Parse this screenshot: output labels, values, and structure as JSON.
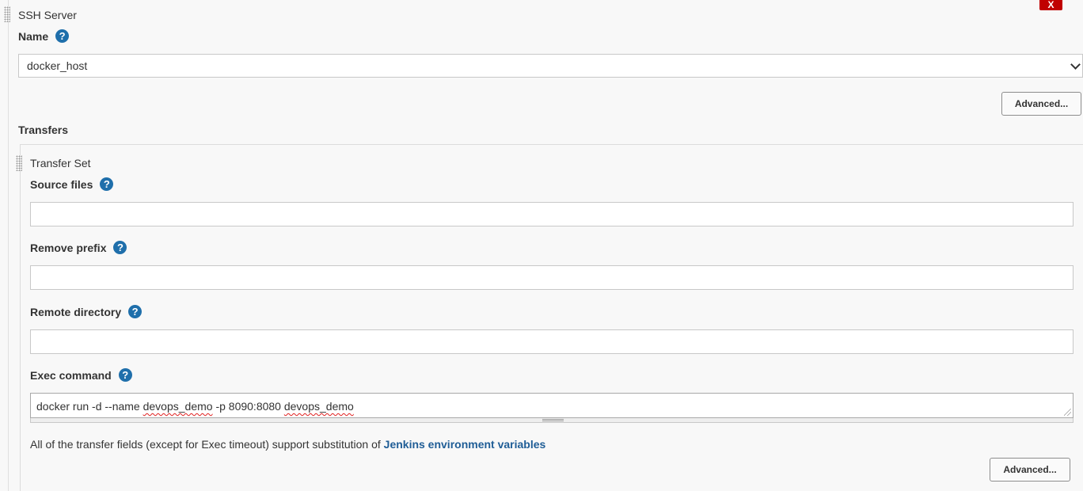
{
  "ssh_server": {
    "section_title": "SSH Server",
    "delete_label": "X",
    "name_label": "Name",
    "name_selected": "docker_host",
    "advanced_label": "Advanced..."
  },
  "transfers": {
    "title": "Transfers",
    "transfer_set": {
      "title": "Transfer Set",
      "source_files_label": "Source files",
      "source_files_value": "",
      "remove_prefix_label": "Remove prefix",
      "remove_prefix_value": "",
      "remote_directory_label": "Remote directory",
      "remote_directory_value": "",
      "exec_command_label": "Exec command",
      "exec_command_parts": [
        "docker run -d --name ",
        "devops_demo",
        " -p 8090:8080 ",
        "devops_demo"
      ],
      "info_text": "All of the transfer fields (except for Exec timeout) support substitution of ",
      "info_link": "Jenkins environment variables",
      "advanced_label": "Advanced..."
    }
  },
  "icons": {
    "help": "help-question-icon",
    "drag": "drag-handle-icon",
    "dropdown": "chevron-down-icon"
  },
  "colors": {
    "help_icon": "#1f6fab",
    "delete_button": "#c00000",
    "link": "#1f5d96",
    "background": "#f8f8f8"
  }
}
